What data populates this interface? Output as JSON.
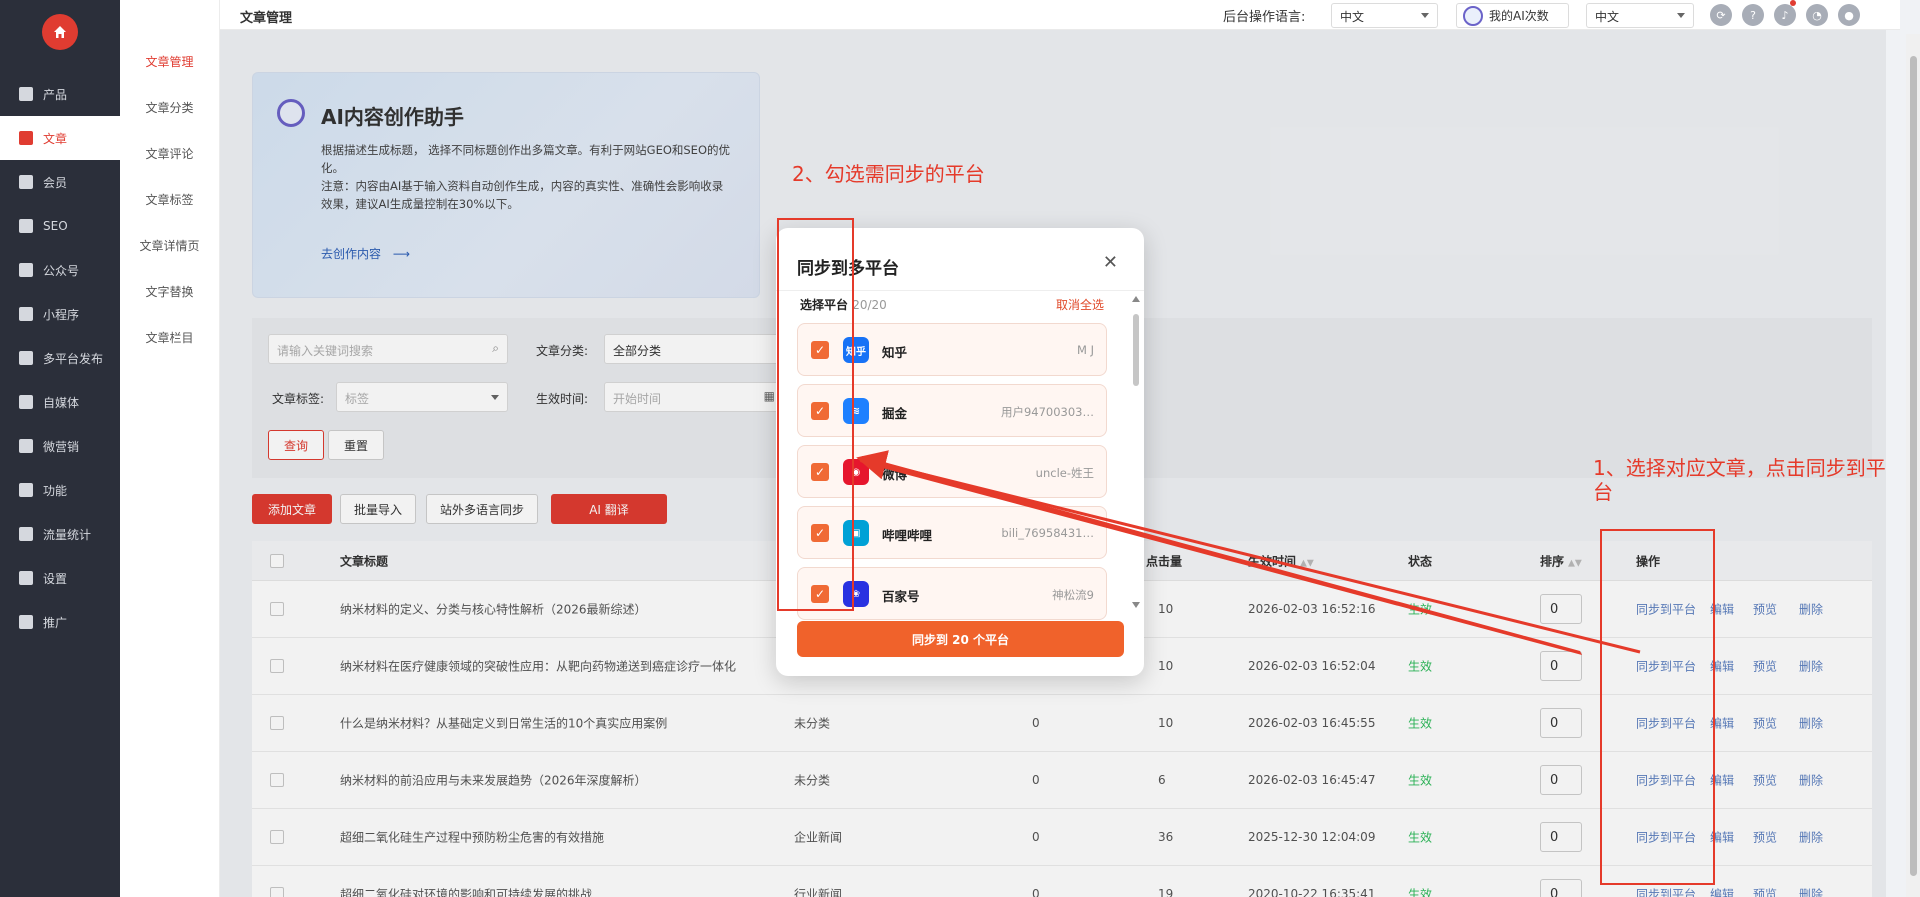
{
  "sidebar": {
    "logo": "home-icon",
    "items": [
      {
        "label": "产品",
        "icon": "grid-icon"
      },
      {
        "label": "文章",
        "icon": "document-icon",
        "active": true
      },
      {
        "label": "会员",
        "icon": "user-icon"
      },
      {
        "label": "SEO",
        "icon": "file-icon"
      },
      {
        "label": "公众号",
        "icon": "wechat-icon"
      },
      {
        "label": "小程序",
        "icon": "miniapp-icon"
      },
      {
        "label": "多平台发布",
        "icon": "file-icon"
      },
      {
        "label": "自媒体",
        "icon": "v-icon"
      },
      {
        "label": "微营销",
        "icon": "bag-icon"
      },
      {
        "label": "功能",
        "icon": "puzzle-icon"
      },
      {
        "label": "流量统计",
        "icon": "bar-chart-icon"
      },
      {
        "label": "设置",
        "icon": "gear-icon"
      },
      {
        "label": "推广",
        "icon": "growth-icon"
      }
    ]
  },
  "subnav": {
    "items": [
      "文章管理",
      "文章分类",
      "文章评论",
      "文章标签",
      "文章详情页",
      "文字替换",
      "文章栏目"
    ]
  },
  "topbar": {
    "title": "文章管理",
    "lang_label": "后台操作语言:",
    "lang_value": "中文",
    "ai_label": "我的AI次数",
    "lang2_value": "中文"
  },
  "ai_card": {
    "title": "AI内容创作助手",
    "desc1": "根据描述生成标题， 选择不同标题创作出多篇文章。有利于网站GEO和SEO的优化。",
    "desc2": "注意：内容由AI基于输入资料自动创作生成，内容的真实性、准确性会影响收录效果，建议AI生成量控制在30%以下。",
    "link": "去创作内容"
  },
  "filters": {
    "keyword_placeholder": "请输入关键词搜索",
    "category_label": "文章分类:",
    "category_value": "全部分类",
    "tag_label": "文章标签:",
    "tag_placeholder": "标签",
    "time_label": "生效时间:",
    "time_placeholder": "开始时间",
    "query": "查询",
    "reset": "重置"
  },
  "actions": {
    "add": "添加文章",
    "batch": "批量导入",
    "multilang": "站外多语言同步",
    "translate": "AI 翻译"
  },
  "table": {
    "headers": {
      "title": "文章标题",
      "clicks": "点击量",
      "time": "生效时间",
      "status": "状态",
      "order": "排序",
      "ops": "操作"
    },
    "ops_labels": {
      "sync": "同步到平台",
      "edit": "编辑",
      "preview": "预览",
      "delete": "删除"
    },
    "rows": [
      {
        "title": "纳米材料的定义、分类与核心特性解析（2026最新综述）",
        "category": "",
        "c1": "",
        "clicks": "10",
        "time": "2026-02-03 16:52:16",
        "status": "生效",
        "order": "0"
      },
      {
        "title": "纳米材料在医疗健康领域的突破性应用：从靶向药物递送到癌症诊疗一体化",
        "category": "",
        "c1": "",
        "clicks": "10",
        "time": "2026-02-03 16:52:04",
        "status": "生效",
        "order": "0"
      },
      {
        "title": "什么是纳米材料？从基础定义到日常生活的10个真实应用案例",
        "category": "未分类",
        "c1": "0",
        "clicks": "10",
        "time": "2026-02-03 16:45:55",
        "status": "生效",
        "order": "0"
      },
      {
        "title": "纳米材料的前沿应用与未来发展趋势（2026年深度解析）",
        "category": "未分类",
        "c1": "0",
        "clicks": "6",
        "time": "2026-02-03 16:45:47",
        "status": "生效",
        "order": "0"
      },
      {
        "title": "超细二氧化硅生产过程中预防粉尘危害的有效措施",
        "category": "企业新闻",
        "c1": "0",
        "clicks": "36",
        "time": "2025-12-30 12:04:09",
        "status": "生效",
        "order": "0"
      },
      {
        "title": "超细二氧化硅对环境的影响和可持续发展的挑战",
        "category": "行业新闻",
        "c1": "0",
        "clicks": "19",
        "time": "2020-10-22 16:35:41",
        "status": "生效",
        "order": "0"
      }
    ]
  },
  "modal": {
    "title": "同步到多平台",
    "select_label": "选择平台",
    "select_count": "20/20",
    "unselect": "取消全选",
    "platforms": [
      {
        "name": "知乎",
        "user": "M J",
        "icon": "zhihu-icon",
        "color": "#1772f6",
        "glyph": "知乎"
      },
      {
        "name": "掘金",
        "user": "用户94700303…",
        "icon": "juejin-icon",
        "color": "#1e80ff",
        "glyph": "≋"
      },
      {
        "name": "微博",
        "user": "uncle-姓王",
        "icon": "weibo-icon",
        "color": "#e6162d",
        "glyph": "◉"
      },
      {
        "name": "哔哩哔哩",
        "user": "bili_76958431…",
        "icon": "bilibili-icon",
        "color": "#00a1d6",
        "glyph": "▣"
      },
      {
        "name": "百家号",
        "user": "神松流9",
        "icon": "baijiahao-icon",
        "color": "#2932e1",
        "glyph": "❀"
      }
    ],
    "submit": "同步到 20 个平台"
  },
  "annotations": {
    "step1": "1、选择对应文章，点击同步到平台",
    "step2": "2、勾选需同步的平台"
  }
}
